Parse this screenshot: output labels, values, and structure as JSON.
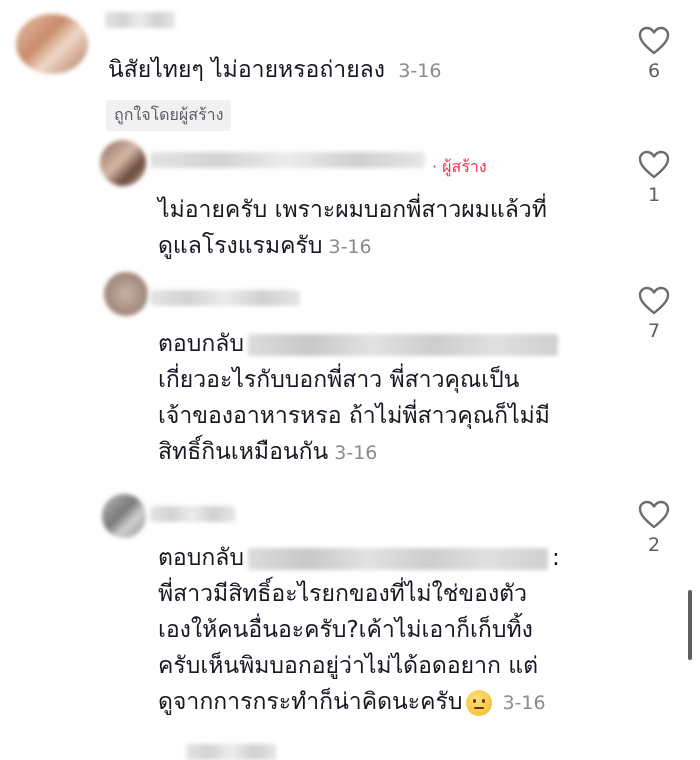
{
  "comments": [
    {
      "text": "นิสัยไทยๆ ไม่อายหรอถ่ายลง",
      "date": "3-16",
      "liked_by_creator": "ถูกใจโดยผู้สร้าง",
      "likes": "6"
    },
    {
      "creator_badge": "· ผู้สร้าง",
      "lines": [
        "ไม่อายครับ เพราะผมบอกพี่สาวผมแล้วที่",
        "ดูแลโรงแรมครับ"
      ],
      "date": "3-16",
      "likes": "1"
    },
    {
      "reply_prefix": "ตอบกลับ",
      "lines": [
        "เกี่ยวอะไรกับบอกพี่สาว พี่สาวคุณเป็น",
        "เจ้าของอาหารหรอ ถ้าไม่พี่สาวคุณก็ไม่มี",
        "สิทธิ์กินเหมือนกัน"
      ],
      "date": "3-16",
      "likes": "7"
    },
    {
      "reply_prefix": "ตอบกลับ",
      "reply_suffix": ":",
      "lines": [
        "พี่สาวมีสิทธิ์อะไรยกของที่ไม่ใช่ของตัว",
        "เองให้คนอื่นอะครับ?เค้าไม่เอาก็เก็บทิ้ง",
        "ครับเห็นพิมบอกอยู่ว่าไม่ได้อดอยาก แต่",
        "ดูจากการกระทำก็น่าคิดนะครับ"
      ],
      "date": "3-16",
      "likes": "2"
    }
  ],
  "icons": {
    "like": "heart-outline-icon",
    "emoji": "thinking-face-emoji"
  },
  "colors": {
    "creator_badge": "#fe2c55",
    "date": "#8a8b91",
    "text": "#161823"
  }
}
